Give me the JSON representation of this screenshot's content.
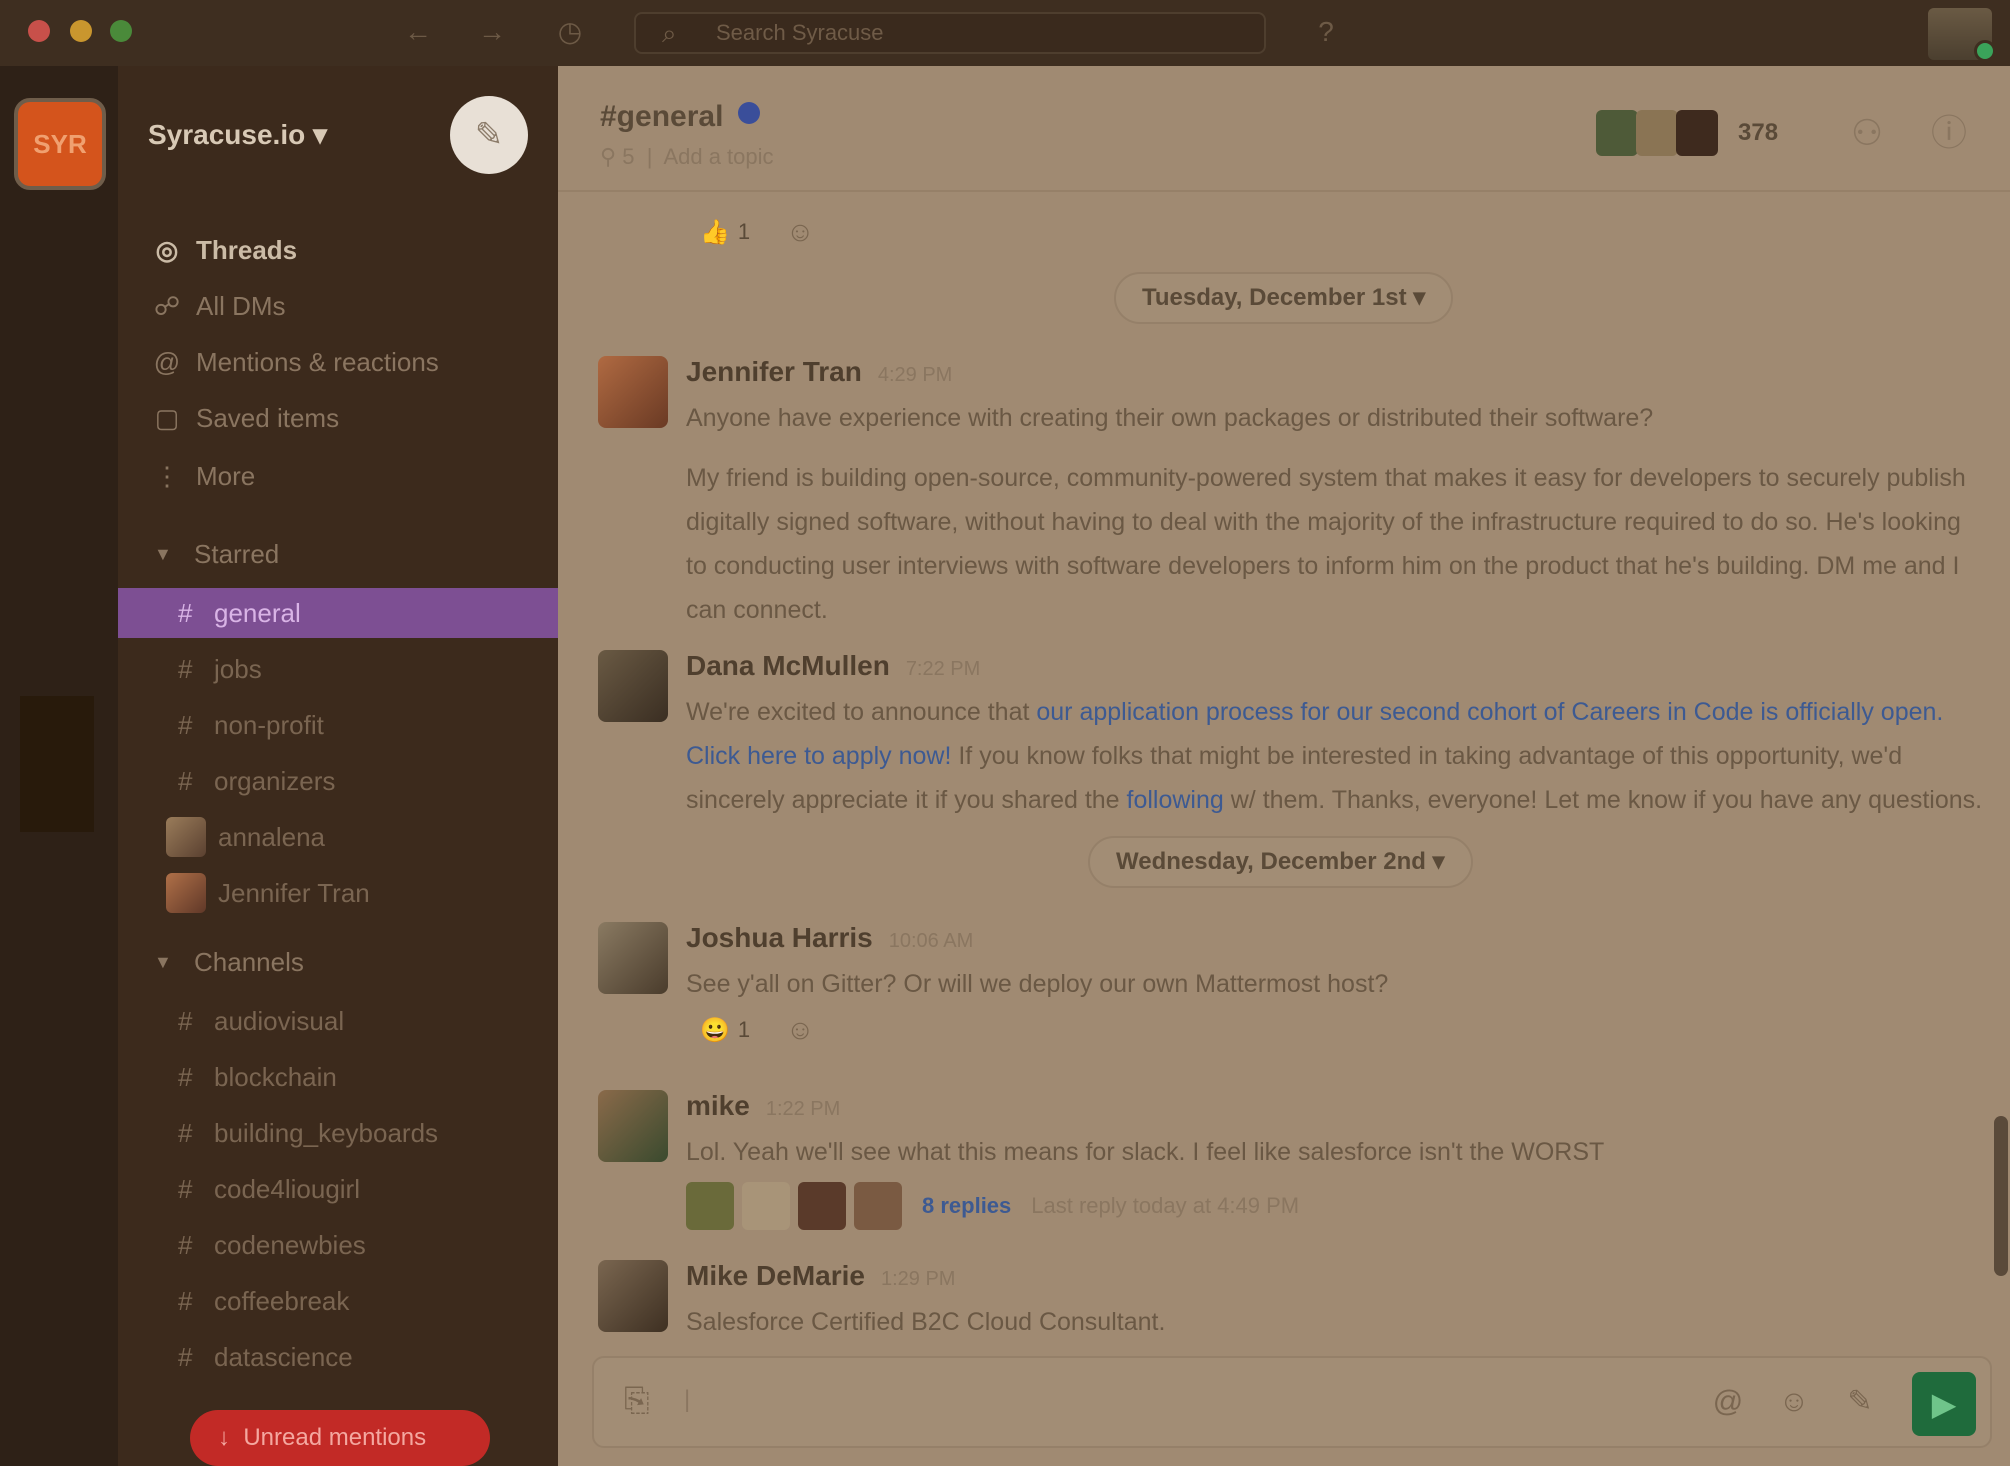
{
  "titlebar": {
    "search_placeholder": "Search Syracuse",
    "nav_back_icon": "arrow-left-icon",
    "nav_forward_icon": "arrow-right-icon",
    "history_icon": "clock-icon",
    "help_icon": "help-icon"
  },
  "colors": {
    "accent_active_channel": "#7d4f93",
    "send_button": "#1f6b3c",
    "unread_pill": "#c22a26",
    "link": "#3d5a92"
  },
  "team": {
    "initials": "SYR"
  },
  "sidebar": {
    "workspace_name": "Syracuse.io",
    "nav": [
      {
        "label": "Threads",
        "icon": "threads-icon"
      },
      {
        "label": "All DMs",
        "icon": "dms-icon"
      },
      {
        "label": "Mentions & reactions",
        "icon": "at-icon"
      },
      {
        "label": "Saved items",
        "icon": "bookmark-icon"
      },
      {
        "label": "More",
        "icon": "more-icon"
      }
    ],
    "starred_label": "Starred",
    "starred": [
      {
        "label": "general",
        "active": true
      },
      {
        "label": "jobs"
      },
      {
        "label": "non-profit"
      },
      {
        "label": "organizers"
      }
    ],
    "dms": [
      {
        "label": "annalena"
      },
      {
        "label": "Jennifer Tran"
      }
    ],
    "channels_label": "Channels",
    "channels": [
      {
        "label": "audiovisual"
      },
      {
        "label": "blockchain"
      },
      {
        "label": "building_keyboards"
      },
      {
        "label": "code4liougirl"
      },
      {
        "label": "codenewbies"
      },
      {
        "label": "coffeebreak"
      },
      {
        "label": "datascience"
      }
    ],
    "unread_mentions": "Unread mentions"
  },
  "channel": {
    "title": "#general",
    "members_meta": "5",
    "topic_placeholder": "Add a topic",
    "member_count": "378"
  },
  "messages": {
    "date1": "Tuesday, December 1st",
    "date2": "Wednesday, December 2nd",
    "reaction_top": "1",
    "reaction_joshua": "1",
    "list": [
      {
        "author": "Jennifer Tran",
        "time": "4:29 PM",
        "p1": "Anyone have experience with creating their own packages or distributed their software?",
        "p2": "My friend is building open-source, community-powered system that makes it easy for developers to securely publish digitally signed software, without having to deal with the majority of the infrastructure required to do so. He's looking to conducting user interviews with software developers to inform him on the product that he's building. DM me and I can connect."
      },
      {
        "author": "Dana McMullen",
        "time": "7:22 PM",
        "p1_a": "We're excited to announce that ",
        "p1_link1": "our application process for our second cohort of Careers in Code is officially open. Click here to apply now!",
        "p1_b": " If you know folks that might be interested in taking advantage of this opportunity, we'd sincerely appreciate it if you shared the ",
        "p1_link2": "following",
        "p1_c": " w/ them. Thanks, everyone! Let me know if you have any questions."
      },
      {
        "author": "Joshua Harris",
        "time": "10:06 AM",
        "p1": "See y'all on Gitter? Or will we deploy our own Mattermost host?"
      },
      {
        "author": "mike",
        "time": "1:22 PM",
        "p1": "Lol. Yeah we'll see what this means for slack. I feel like salesforce isn't the WORST",
        "replies": "8 replies",
        "last_reply": "Last reply today at 4:49 PM"
      },
      {
        "author": "Mike DeMarie",
        "time": "1:29 PM",
        "p1": "Salesforce Certified B2C Cloud Consultant."
      }
    ]
  },
  "composer": {
    "placeholder": "|"
  }
}
